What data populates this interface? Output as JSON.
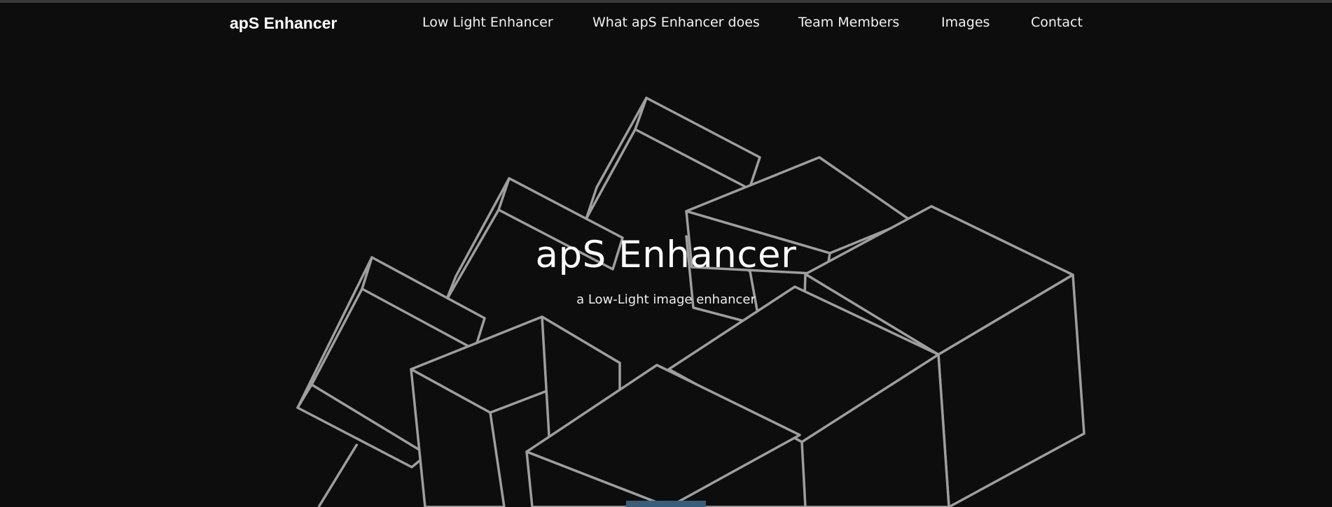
{
  "navbar": {
    "brand": "apS Enhancer",
    "links": [
      {
        "label": "Low Light Enhancer"
      },
      {
        "label": "What apS Enhancer does"
      },
      {
        "label": "Team Members"
      },
      {
        "label": "Images"
      },
      {
        "label": "Contact"
      }
    ]
  },
  "hero": {
    "title": "apS Enhancer",
    "subtitle": "a Low-Light image enhancer",
    "background": "wireframe-cubes-illustration",
    "button_color": "#3b5d78"
  },
  "colors": {
    "background": "#0d0d0d",
    "cube_stroke": "#9e9e9e",
    "text": "#ffffff"
  }
}
